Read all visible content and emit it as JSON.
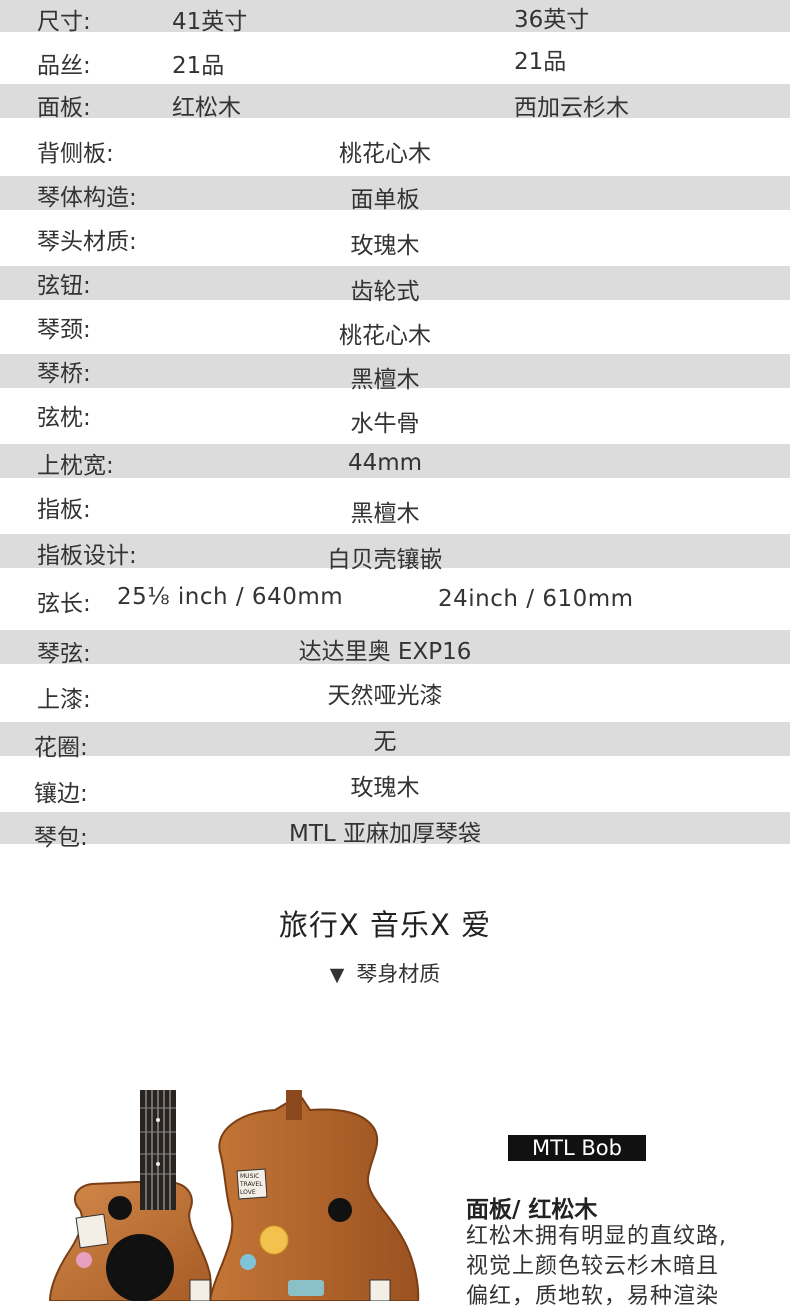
{
  "specs": {
    "size": {
      "label": "尺寸:",
      "v1": "41英寸",
      "v2": "36英寸"
    },
    "frets": {
      "label": "品丝:",
      "v1": "21品",
      "v2": "21品"
    },
    "top": {
      "label": "面板:",
      "v1": "红松木",
      "v2": "西加云杉木"
    },
    "back_sides": {
      "label": "背侧板:",
      "value": "桃花心木"
    },
    "body_build": {
      "label": "琴体构造:",
      "value": "面单板"
    },
    "headstock": {
      "label": "琴头材质:",
      "value": "玫瑰木"
    },
    "tuners": {
      "label": "弦钮:",
      "value": "齿轮式"
    },
    "neck": {
      "label": "琴颈:",
      "value": "桃花心木"
    },
    "bridge": {
      "label": "琴桥:",
      "value": "黑檀木"
    },
    "saddle": {
      "label": "弦枕:",
      "value": "水牛骨"
    },
    "nut_width": {
      "label": "上枕宽:",
      "value": "44mm"
    },
    "fretboard": {
      "label": "指板:",
      "value": "黑檀木"
    },
    "fretboard_design": {
      "label": "指板设计:",
      "value": "白贝壳镶嵌"
    },
    "scale": {
      "label": "弦长:",
      "v1": "25⅛ inch / 640mm",
      "v2": "24inch / 610mm"
    },
    "strings": {
      "label": "琴弦:",
      "value": "达达里奥 EXP16"
    },
    "finish": {
      "label": "上漆:",
      "value": "天然哑光漆"
    },
    "rosette": {
      "label": "花圈:",
      "value": "无"
    },
    "binding": {
      "label": "镶边:",
      "value": "玫瑰木"
    },
    "case": {
      "label": "琴包:",
      "value": "MTL 亚麻加厚琴袋"
    }
  },
  "slogan": "旅行X 音乐X 爱",
  "section": {
    "marker": "▼",
    "title": "琴身材质"
  },
  "product": {
    "tag": "MTL Bob",
    "title": "面板/ 红松木",
    "desc_lines": [
      "红松木拥有明显的直纹路,",
      "视觉上颜色较云杉木暗且",
      "偏红，质地软，易种渲染"
    ],
    "sticker_text": [
      "MUSIC",
      "TRAVEL",
      "LOVE"
    ]
  },
  "colors": {
    "row_gray": "#dcdcdc",
    "wood": "#c8763a",
    "wood_dark": "#8a4a1e"
  }
}
